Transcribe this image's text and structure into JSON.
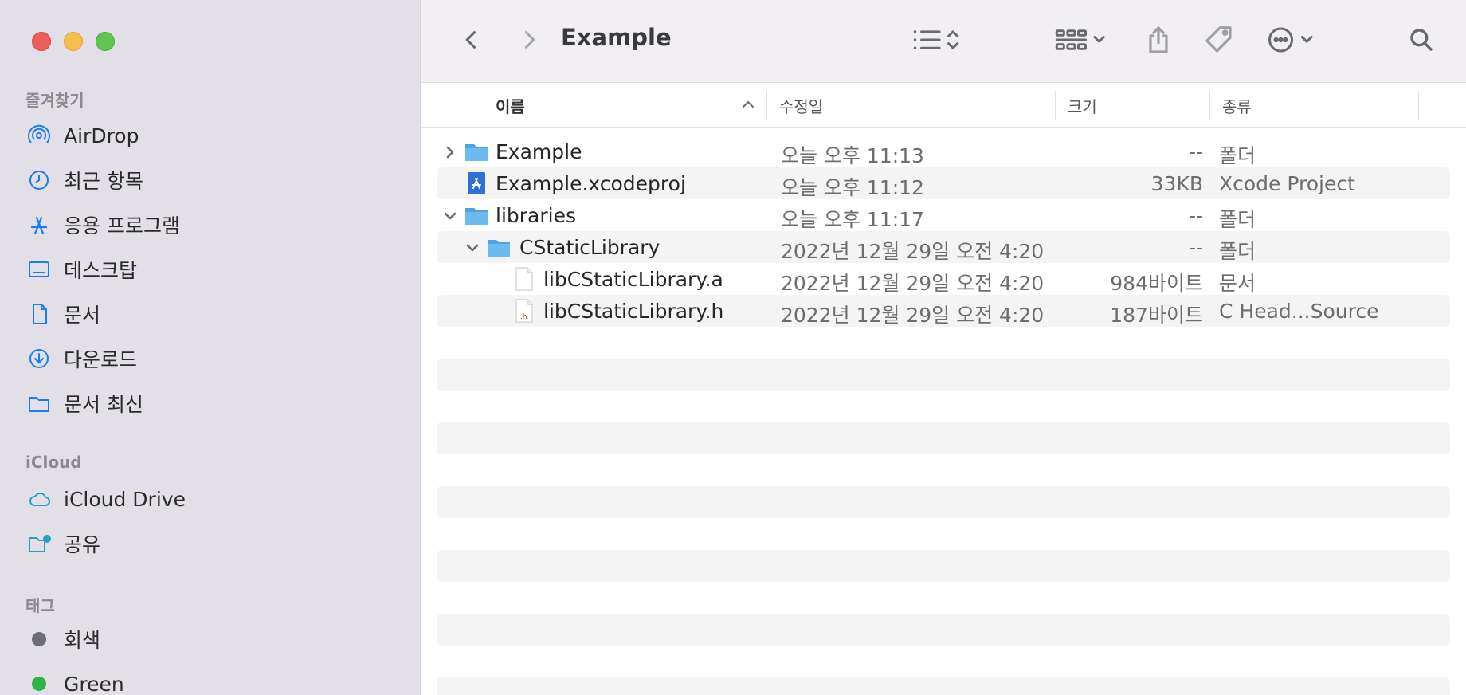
{
  "window": {
    "title": "Example"
  },
  "sidebar": {
    "favorites_header": "즐겨찾기",
    "favorites": [
      {
        "label": "AirDrop",
        "icon": "airdrop-icon"
      },
      {
        "label": "최근 항목",
        "icon": "clock-icon"
      },
      {
        "label": "응용 프로그램",
        "icon": "applications-icon"
      },
      {
        "label": "데스크탑",
        "icon": "desktop-icon"
      },
      {
        "label": "문서",
        "icon": "document-icon"
      },
      {
        "label": "다운로드",
        "icon": "download-icon"
      },
      {
        "label": "문서 최신",
        "icon": "folder-icon"
      }
    ],
    "icloud_header": "iCloud",
    "icloud": [
      {
        "label": "iCloud Drive",
        "icon": "cloud-icon"
      },
      {
        "label": "공유",
        "icon": "shared-folder-icon"
      }
    ],
    "tags_header": "태그",
    "tags": [
      {
        "label": "회색",
        "color": "#6e6e72"
      },
      {
        "label": "Green",
        "color": "#2fb344"
      }
    ]
  },
  "toolbar": {
    "back": "chevron-left-icon",
    "forward": "chevron-right-icon",
    "view": "list-view-icon",
    "group": "group-icon",
    "share": "share-icon",
    "tag": "tag-icon",
    "more": "ellipsis-icon",
    "search": "search-icon"
  },
  "columns": {
    "name": "이름",
    "modified": "수정일",
    "size": "크기",
    "kind": "종류"
  },
  "rows": [
    {
      "name": "Example",
      "date": "오늘 오후 11:13",
      "size": "--",
      "kind": "폴더",
      "type": "folder",
      "expanded": false
    },
    {
      "name": "Example.xcodeproj",
      "date": "오늘 오후 11:12",
      "size": "33KB",
      "kind": "Xcode Project",
      "type": "xcodeproj"
    },
    {
      "name": "libraries",
      "date": "오늘 오후 11:17",
      "size": "--",
      "kind": "폴더",
      "type": "folder",
      "expanded": true
    },
    {
      "name": "CStaticLibrary",
      "date": "2022년 12월 29일 오전 4:20",
      "size": "--",
      "kind": "폴더",
      "type": "folder",
      "expanded": true
    },
    {
      "name": "libCStaticLibrary.a",
      "date": "2022년 12월 29일 오전 4:20",
      "size": "984바이트",
      "kind": "문서",
      "type": "file"
    },
    {
      "name": "libCStaticLibrary.h",
      "date": "2022년 12월 29일 오전 4:20",
      "size": "187바이트",
      "kind": "C Head...Source",
      "type": "header",
      "badge": ".h"
    }
  ],
  "colors": {
    "sidebar_bg": "#e3dfe6",
    "accent": "#1a7cf5",
    "folder": "#5fb1ed",
    "stripe": "#f4f4f5"
  }
}
